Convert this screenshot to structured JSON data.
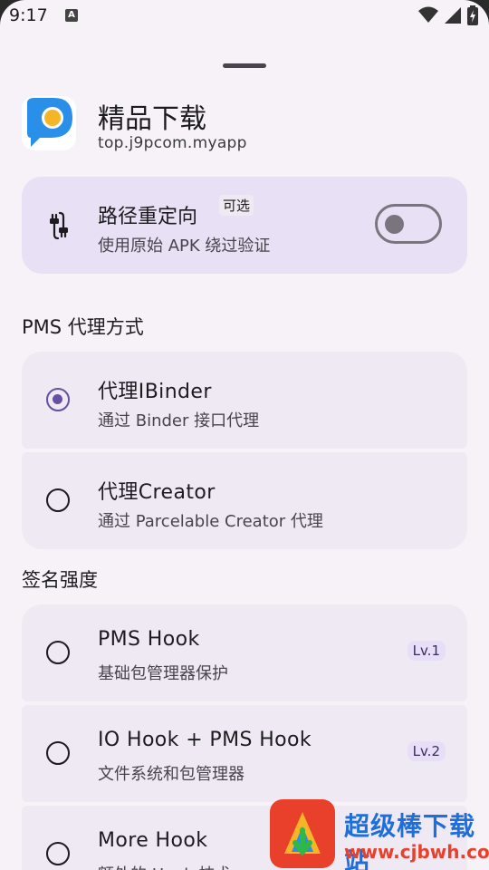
{
  "status_bar": {
    "time": "9:17",
    "notification_icon": "A"
  },
  "app": {
    "name": "精品下载",
    "package": "top.j9pcom.myapp"
  },
  "redirect": {
    "title": "路径重定向",
    "tag": "可选",
    "subtitle": "使用原始 APK 绕过验证",
    "enabled": false
  },
  "pms_section": {
    "title": "PMS 代理方式",
    "options": [
      {
        "label": "代理IBinder",
        "desc": "通过 Binder 接口代理",
        "selected": true
      },
      {
        "label": "代理Creator",
        "desc": "通过 Parcelable Creator 代理",
        "selected": false
      }
    ]
  },
  "sig_section": {
    "title": "签名强度",
    "options": [
      {
        "label": "PMS Hook",
        "desc": "基础包管理器保护",
        "level": "Lv.1",
        "selected": false
      },
      {
        "label": "IO Hook + PMS Hook",
        "desc": "文件系统和包管理器",
        "level": "Lv.2",
        "selected": false
      },
      {
        "label": "More Hook",
        "desc": "额外的 Hook 技术",
        "selected": false
      }
    ]
  },
  "watermark": {
    "line1": "超级棒下载站",
    "line2": "www.cjbwh.com"
  },
  "colors": {
    "accent": "#6750a4",
    "card_highlight": "#e8e0f4",
    "card": "#efe9f4"
  },
  "icons": [
    "wifi-icon",
    "signal-icon",
    "battery-icon",
    "cable-icon",
    "radio-button-icon"
  ]
}
